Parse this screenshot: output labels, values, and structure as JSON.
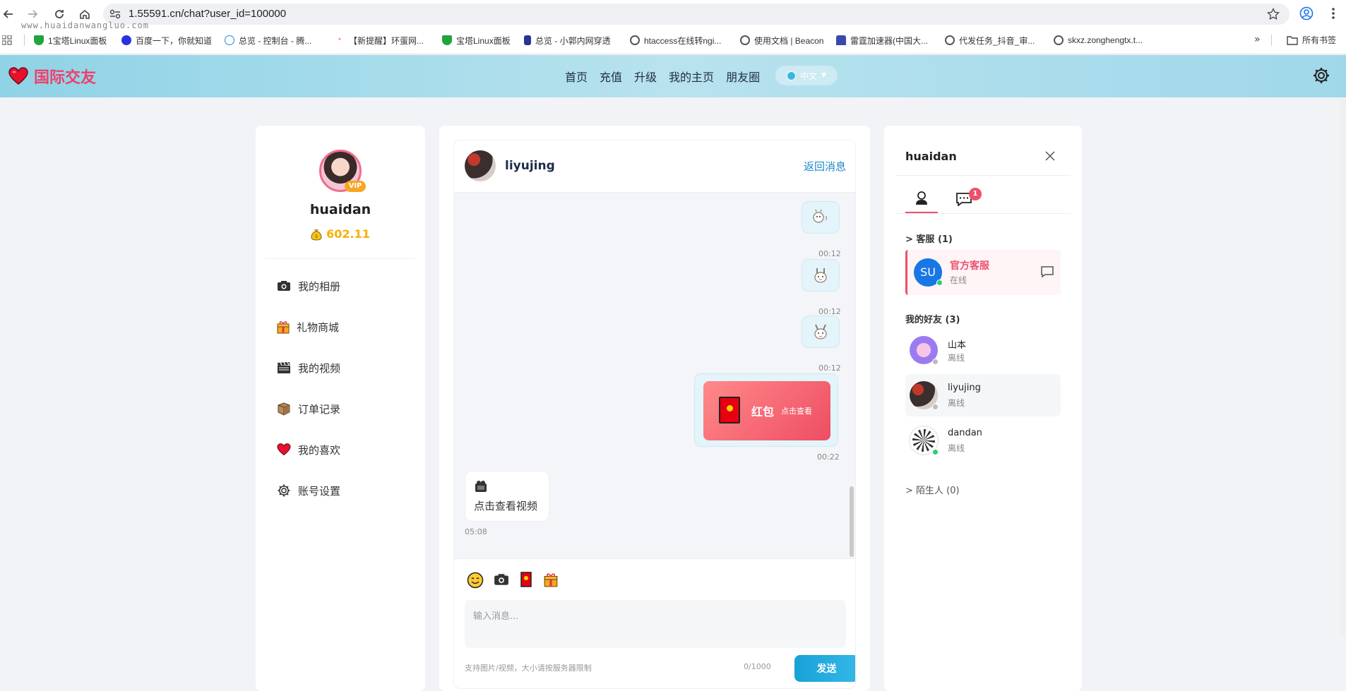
{
  "browser": {
    "url": "1.55591.cn/chat?user_id=100000",
    "watermark": "www.huaidanwangluo.com",
    "bookmarks": [
      {
        "label": "1宝塔Linux面板",
        "color": "#20a53a"
      },
      {
        "label": "百度一下，你就知道",
        "color": "#2932e1"
      },
      {
        "label": "总览 - 控制台 - 腾...",
        "color": "#1e88e5"
      },
      {
        "label": "【新提醒】环蛋网...",
        "color": "#e53935"
      },
      {
        "label": "宝塔Linux面板",
        "color": "#20a53a"
      },
      {
        "label": "总览 - 小郭内网穿透",
        "color": "#283593"
      },
      {
        "label": "htaccess在线转ngi...",
        "color": "#555555"
      },
      {
        "label": "使用文档 | Beacon",
        "color": "#555555"
      },
      {
        "label": "雷霆加速器(中国大...",
        "color": "#3949ab"
      },
      {
        "label": "代发任务_抖音_审...",
        "color": "#555555"
      },
      {
        "label": "skxz.zonghengtx.t...",
        "color": "#555555"
      }
    ],
    "more": "»",
    "all_bookmarks": "所有书签"
  },
  "header": {
    "logo_text": "国际交友",
    "nav": [
      "首页",
      "充值",
      "升级",
      "我的主页",
      "朋友圈"
    ],
    "lang": "中文"
  },
  "sidebar": {
    "username": "huaidan",
    "vip_badge": "VIP",
    "balance": "602.11",
    "menu": [
      {
        "label": "我的相册",
        "icon": "camera-icon"
      },
      {
        "label": "礼物商城",
        "icon": "gift-icon"
      },
      {
        "label": "我的视频",
        "icon": "clapper-icon"
      },
      {
        "label": "订单记录",
        "icon": "box-icon"
      },
      {
        "label": "我的喜欢",
        "icon": "heart-icon"
      },
      {
        "label": "账号设置",
        "icon": "gear-icon"
      }
    ]
  },
  "chat": {
    "name": "liyujing",
    "back": "返回消息",
    "messages": [
      {
        "type": "sticker",
        "time": "00:12"
      },
      {
        "type": "sticker",
        "time": "00:12"
      },
      {
        "type": "sticker",
        "time": "00:12"
      },
      {
        "type": "red-packet",
        "title": "红包",
        "sub": "点击查看",
        "time": "00:22"
      },
      {
        "type": "video",
        "text": "点击查看视频",
        "time": "05:08"
      }
    ],
    "placeholder": "输入消息...",
    "hint": "支持图片/视频，大小请按服务器限制",
    "count": "0/1000",
    "send": "发送"
  },
  "panel": {
    "title": "huaidan",
    "badge": "1",
    "service_section": "> 客服 (1)",
    "service": {
      "avatar": "SU",
      "name": "官方客服",
      "status": "在线"
    },
    "friends_section": "我的好友 (3)",
    "friends": [
      {
        "name": "山本",
        "status": "离线"
      },
      {
        "name": "liyujing",
        "status": "离线"
      },
      {
        "name": "dandan",
        "status": "离线"
      }
    ],
    "strangers": "> 陌生人 (0)"
  },
  "colors": {
    "accent": "#ef4f6b",
    "primary": "#1e88c8",
    "header": "#9fd8ea",
    "gold": "#f5b100"
  }
}
